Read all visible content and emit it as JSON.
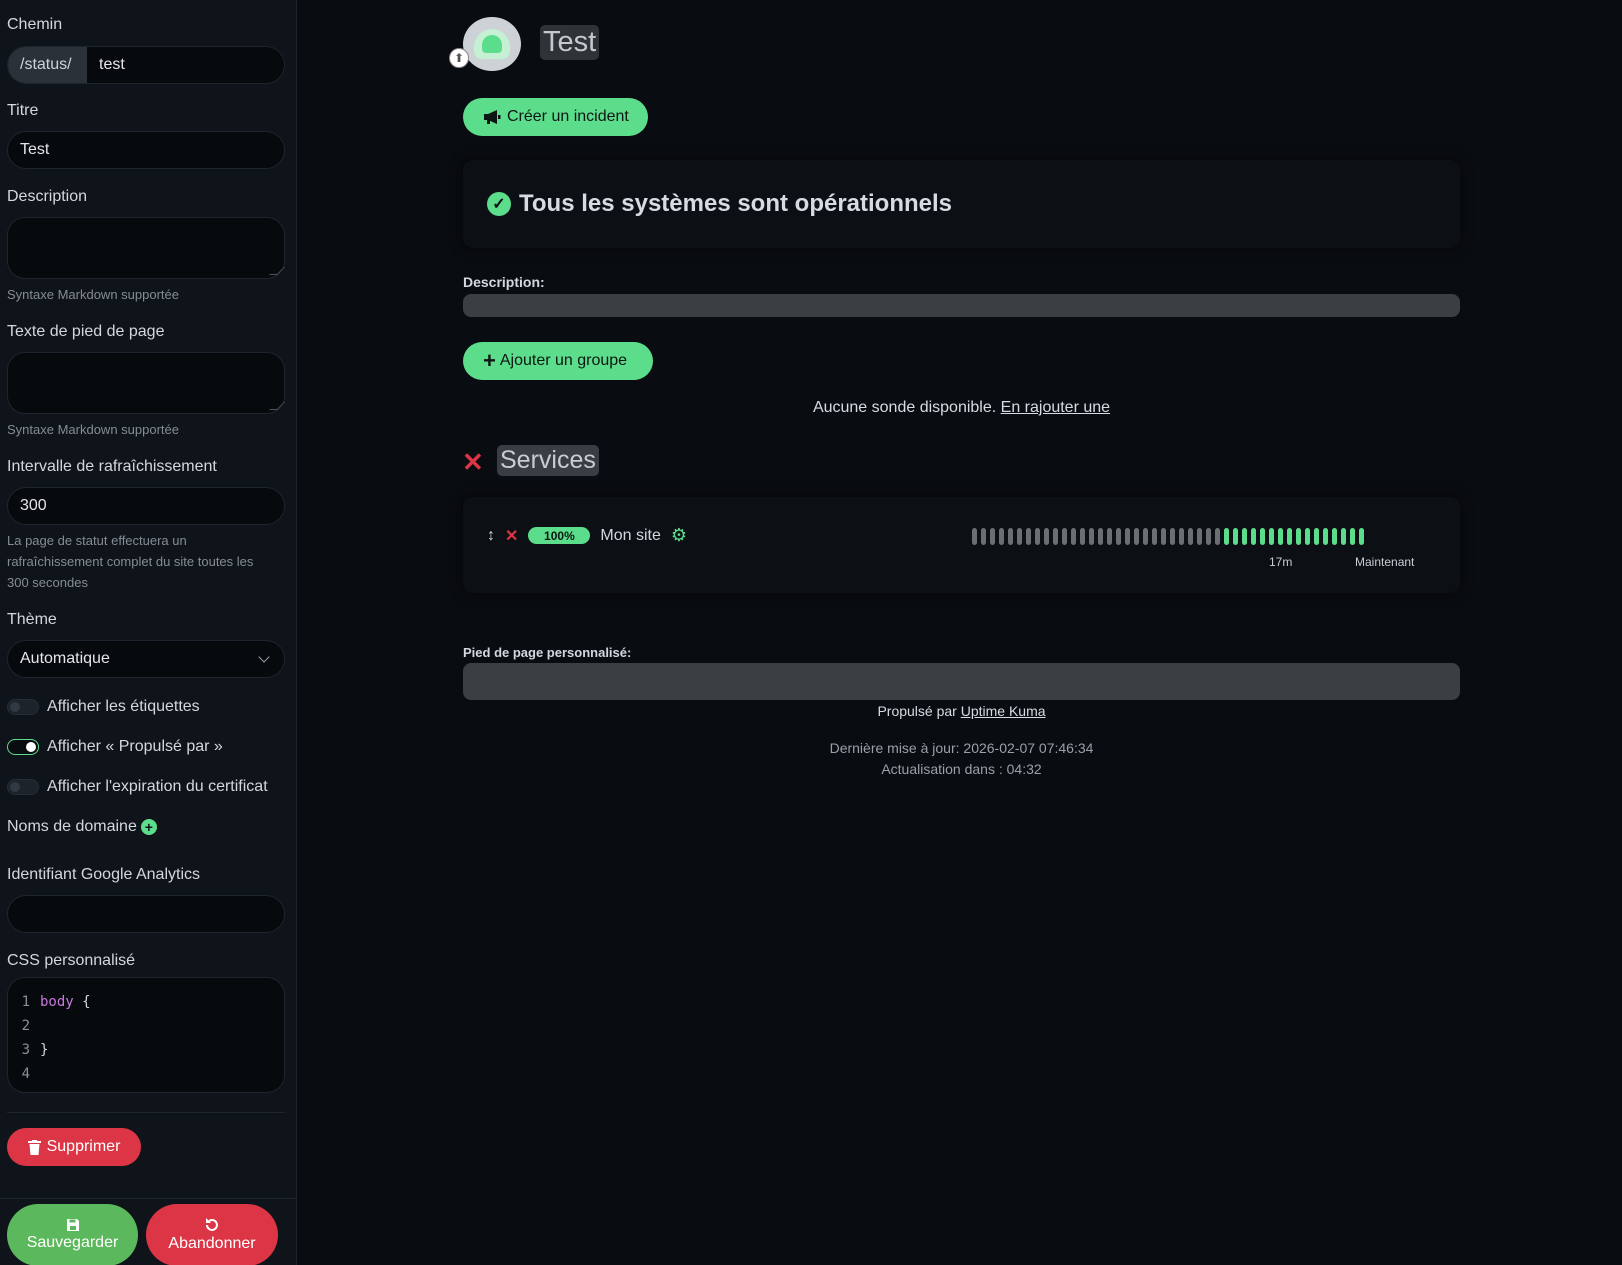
{
  "sidebar": {
    "path_label": "Chemin",
    "path_prefix": "/status/",
    "path_value": "test",
    "title_label": "Titre",
    "title_value": "Test",
    "description_label": "Description",
    "markdown_hint": "Syntaxe Markdown supportée",
    "footer_label": "Texte de pied de page",
    "footer_hint": "Syntaxe Markdown supportée",
    "refresh_label": "Intervalle de rafraîchissement",
    "refresh_value": "300",
    "refresh_hint": "La page de statut effectuera un rafraîchissement complet du site toutes les 300 secondes",
    "theme_label": "Thème",
    "theme_value": "Automatique",
    "toggles": [
      {
        "label": "Afficher les étiquettes",
        "on": false
      },
      {
        "label": "Afficher « Propulsé par »",
        "on": true
      },
      {
        "label": "Afficher l'expiration du certificat",
        "on": false
      }
    ],
    "domains_label": "Noms de domaine",
    "ga_label": "Identifiant Google Analytics",
    "css_label": "CSS personnalisé",
    "css_lines": [
      {
        "n": "1",
        "code": "body",
        "brace": "{"
      },
      {
        "n": "2",
        "code": "",
        "brace": ""
      },
      {
        "n": "3",
        "code": "",
        "brace": "}"
      },
      {
        "n": "4",
        "code": "",
        "brace": ""
      }
    ],
    "delete_label": "Supprimer",
    "save_label": "Sauvegarder",
    "discard_label": "Abandonner"
  },
  "main": {
    "page_title": "Test",
    "create_incident_label": "Créer un incident",
    "status_text": "Tous les systèmes sont opérationnels",
    "description_label": "Description:",
    "add_group_label": "Ajouter un groupe",
    "no_monitor_text": "Aucune sonde disponible.",
    "add_monitor_link": "En rajouter une",
    "group_name": "Services",
    "monitor": {
      "uptime": "100%",
      "name": "Mon site",
      "beats_total": 44,
      "beats_up": 16,
      "time_start": "17m",
      "time_end": "Maintenant"
    },
    "custom_footer_label": "Pied de page personnalisé:",
    "powered_by": "Propulsé par",
    "powered_by_link": "Uptime Kuma",
    "last_update": "Dernière mise à jour: 2026-02-07 07:46:34",
    "refresh_in": "Actualisation dans : 04:32"
  },
  "colors": {
    "accent": "#5cdd8b",
    "danger": "#dc3545",
    "success": "#5cb85c",
    "background": "#090c10"
  }
}
